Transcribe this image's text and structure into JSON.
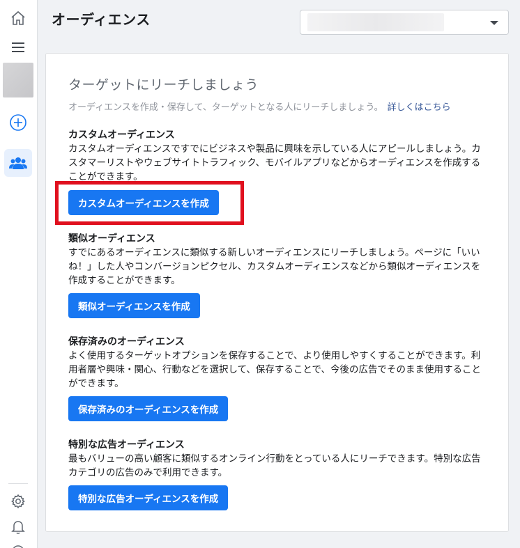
{
  "header": {
    "title": "オーディエンス"
  },
  "nav": {
    "home_icon": "home-icon",
    "menu_icon": "hamburger-menu-icon",
    "add_icon": "plus-circle-icon",
    "audience_icon": "people-icon",
    "settings_icon": "gear-icon",
    "notifications_icon": "bell-icon"
  },
  "card": {
    "heading": "ターゲットにリーチしましょう",
    "subtext": "オーディエンスを作成・保存して、ターゲットとなる人にリーチしましょう。",
    "learn_more": "詳しくはこちら"
  },
  "sections": [
    {
      "title": "カスタムオーディエンス",
      "description": "カスタムオーディエンスですでにビジネスや製品に興味を示している人にアピールしましょう。カスタマーリストやウェブサイトトラフィック、モバイルアプリなどからオーディエンスを作成することができます。",
      "button": "カスタムオーディエンスを作成"
    },
    {
      "title": "類似オーディエンス",
      "description": "すでにあるオーディエンスに類似する新しいオーディエンスにリーチしましょう。ページに「いいね！」した人やコンバージョンピクセル、カスタムオーディエンスなどから類似オーディエンスを作成することができます。",
      "button": "類似オーディエンスを作成"
    },
    {
      "title": "保存済みのオーディエンス",
      "description": "よく使用するターゲットオプションを保存することで、より使用しやすくすることができます。利用者層や興味・関心、行動などを選択して、保存することで、今後の広告でそのまま使用することができます。",
      "button": "保存済みのオーディエンスを作成"
    },
    {
      "title": "特別な広告オーディエンス",
      "description": "最もバリューの高い顧客に類似するオンライン行動をとっている人にリーチできます。特別な広告カテゴリの広告のみで利用できます。",
      "button": "特別な広告オーディエンスを作成"
    }
  ],
  "colors": {
    "accent": "#1877f2",
    "highlight": "#e0101e",
    "link": "#385898"
  }
}
